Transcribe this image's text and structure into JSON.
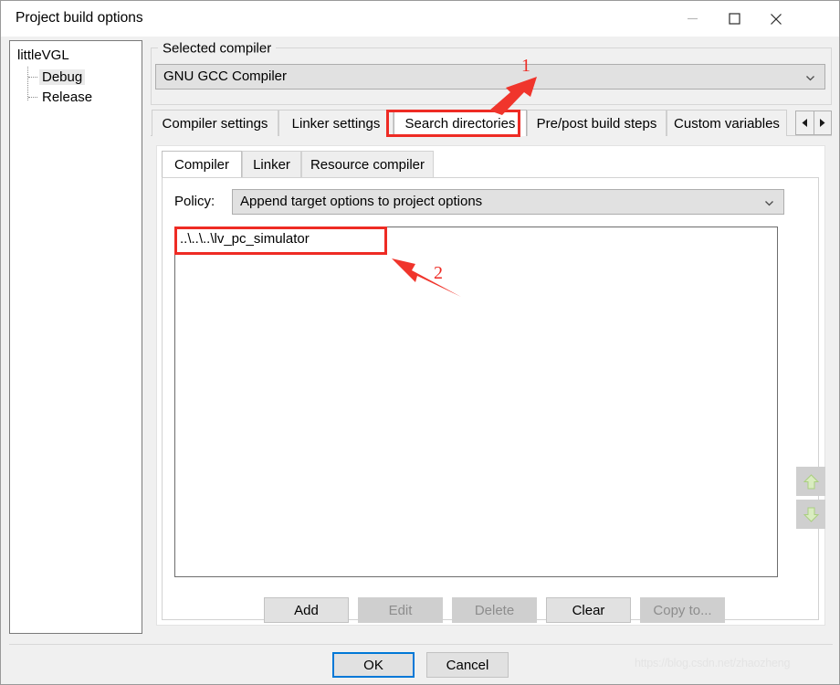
{
  "window": {
    "title": "Project build options",
    "controls": {
      "minimize": "minimize-icon",
      "maximize": "maximize-icon",
      "close": "close-icon"
    }
  },
  "tree": {
    "root": "littleVGL",
    "children": [
      {
        "label": "Debug",
        "selected": true
      },
      {
        "label": "Release",
        "selected": false
      }
    ]
  },
  "compiler_group": {
    "legend": "Selected compiler",
    "selected": "GNU GCC Compiler",
    "arrow_icon": "chevron-down-icon"
  },
  "outer_tabs": {
    "items": [
      {
        "label": "Compiler settings",
        "active": false
      },
      {
        "label": "Linker settings",
        "active": false
      },
      {
        "label": "Search directories",
        "active": true
      },
      {
        "label": "Pre/post build steps",
        "active": false
      },
      {
        "label": "Custom variables",
        "active": false
      }
    ],
    "scroll_left_icon": "triangle-left-icon",
    "scroll_right_icon": "triangle-right-icon"
  },
  "inner_tabs": {
    "items": [
      {
        "label": "Compiler",
        "active": true
      },
      {
        "label": "Linker",
        "active": false
      },
      {
        "label": "Resource compiler",
        "active": false
      }
    ]
  },
  "policy": {
    "label": "Policy:",
    "selected": "Append target options to project options",
    "arrow_icon": "chevron-down-icon"
  },
  "directories": {
    "items": [
      "..\\..\\..\\lv_pc_simulator"
    ]
  },
  "side_buttons": [
    {
      "name": "move-up-button",
      "icon": "arrow-up-icon",
      "enabled": false
    },
    {
      "name": "move-down-button",
      "icon": "arrow-down-icon",
      "enabled": false
    }
  ],
  "action_buttons": [
    {
      "label": "Add",
      "enabled": true
    },
    {
      "label": "Edit",
      "enabled": false
    },
    {
      "label": "Delete",
      "enabled": false
    },
    {
      "label": "Clear",
      "enabled": true
    },
    {
      "label": "Copy to...",
      "enabled": false
    }
  ],
  "dialog_buttons": {
    "ok": "OK",
    "cancel": "Cancel"
  },
  "watermark": "https://blog.csdn.net/zhaozheng",
  "annotations": {
    "marker_1": "1",
    "marker_2": "2",
    "accent_color": "#ee2b24"
  }
}
